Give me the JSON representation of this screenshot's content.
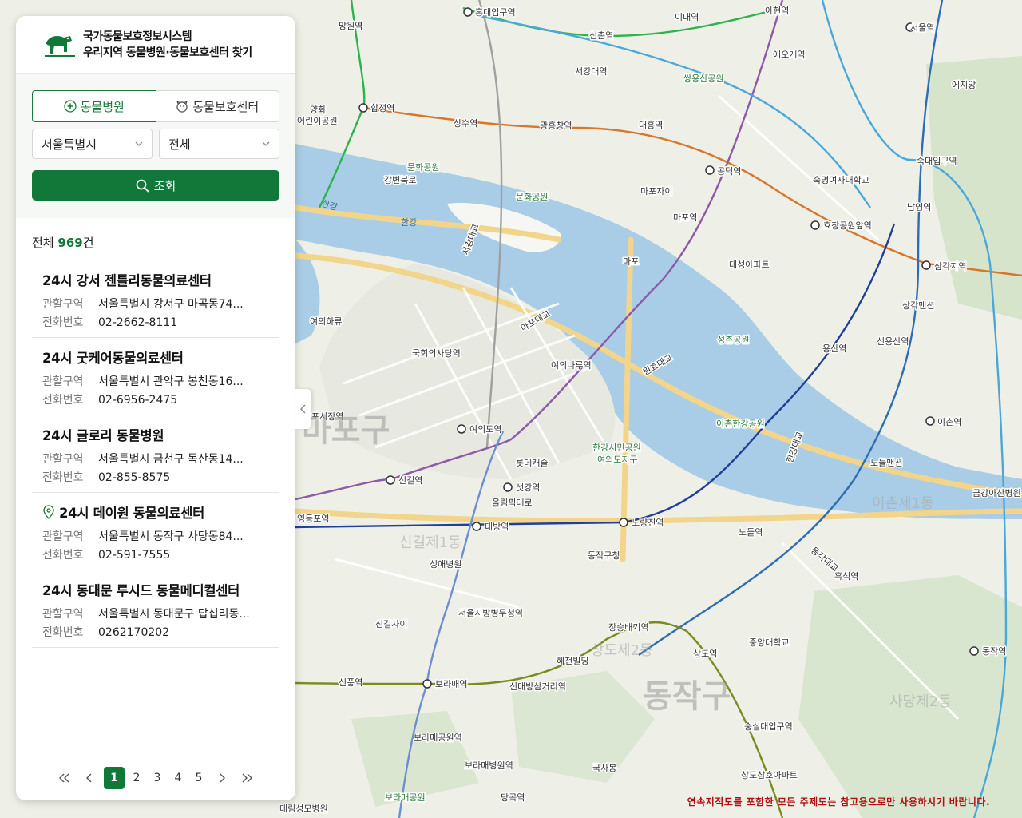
{
  "app": {
    "title_line1": "국가동물보호정보시스템",
    "title_line2": "우리지역 동물병원·동물보호센터 찾기"
  },
  "tabs": [
    {
      "label": "동물병원",
      "active": true
    },
    {
      "label": "동물보호센터",
      "active": false
    }
  ],
  "filters": {
    "region": "서울특별시",
    "district": "전체"
  },
  "search_label": "조회",
  "total": {
    "prefix": "전체",
    "count": "969",
    "suffix": "건"
  },
  "labels": {
    "area": "관할구역",
    "phone": "전화번호"
  },
  "results": [
    {
      "name": "24시 강서 젠틀리동물의료센터",
      "area": "서울특별시 강서구 마곡동74...",
      "phone": "02-2662-8111",
      "pin": false
    },
    {
      "name": "24시 굿케어동물의료센터",
      "area": "서울특별시 관악구 봉천동16...",
      "phone": "02-6956-2475",
      "pin": false
    },
    {
      "name": "24시 글로리 동물병원",
      "area": "서울특별시 금천구 독산동14...",
      "phone": "02-855-8575",
      "pin": false
    },
    {
      "name": "24시 데이원 동물의료센터",
      "area": "서울특별시 동작구 사당동84...",
      "phone": "02-591-7555",
      "pin": true
    },
    {
      "name": "24시 동대문 루시드 동물메디컬센터",
      "area": "서울특별시 동대문구 답십리동...",
      "phone": "0262170202",
      "pin": false
    }
  ],
  "pagination": {
    "pages": [
      "1",
      "2",
      "3",
      "4",
      "5"
    ],
    "current": "1"
  },
  "map": {
    "disclaimer": "연속지적도를 포함한 모든 주제도는 참고용으로만 사용하시기 바랍니다.",
    "districts": [
      "동작구",
      "마포구"
    ],
    "dongs": [
      "사당제2동",
      "이촌제1동",
      "상도제2동",
      "신길제1동"
    ],
    "rivers": [
      "한강"
    ],
    "stations": [
      "홍대입구역",
      "이대역",
      "아현역",
      "신촌역",
      "서울역",
      "망원역",
      "애오개역",
      "합정역",
      "서강대역",
      "상수역",
      "광흥창역",
      "대흥역",
      "공덕역",
      "숙대입구역",
      "마포역",
      "효창공원앞역",
      "남영역",
      "삼각지역",
      "여의나루역",
      "용산역",
      "신용산역",
      "국회의사당역",
      "여의도역",
      "이촌역",
      "샛강역",
      "신길역",
      "대방역",
      "노량진역",
      "노들역",
      "흑석역",
      "동작역",
      "보라매역",
      "신대방삼거리역",
      "장승배기역",
      "상도역",
      "숭실대입구역",
      "신풍역",
      "보라매공원역",
      "보라매병원역",
      "당곡역",
      "서울지방병무청역",
      "신길자이",
      "여의하류",
      "포시장역",
      "영등포역"
    ],
    "places": [
      "쌍용산공원",
      "문화공원",
      "마포자이",
      "대성아파트",
      "성촌공원",
      "숙명여자대학교",
      "상각맨션",
      "이촌한강공원",
      "한강시민공원 여의도지구",
      "롯데캐슬",
      "올림픽대로",
      "동작구청",
      "성애병원",
      "혜천빌딩",
      "중앙대학교",
      "국사봉",
      "상도삼호아파트",
      "보라매공원",
      "대림성모병원",
      "노들맨션",
      "금강아산병원",
      "마포대교",
      "원효대교",
      "한강대교",
      "동작대교",
      "강변북로",
      "서강대교",
      "마포",
      "어린이공원",
      "양화",
      "에지앙"
    ]
  },
  "colors": {
    "accent": "#12783a",
    "disclaimer": "#b01010"
  },
  "icons": [
    "paw-hospital-icon",
    "shelter-icon",
    "chevron-down-icon",
    "search-icon",
    "map-pin-icon",
    "double-left-icon",
    "left-icon",
    "right-icon",
    "double-right-icon",
    "collapse-left-icon"
  ]
}
